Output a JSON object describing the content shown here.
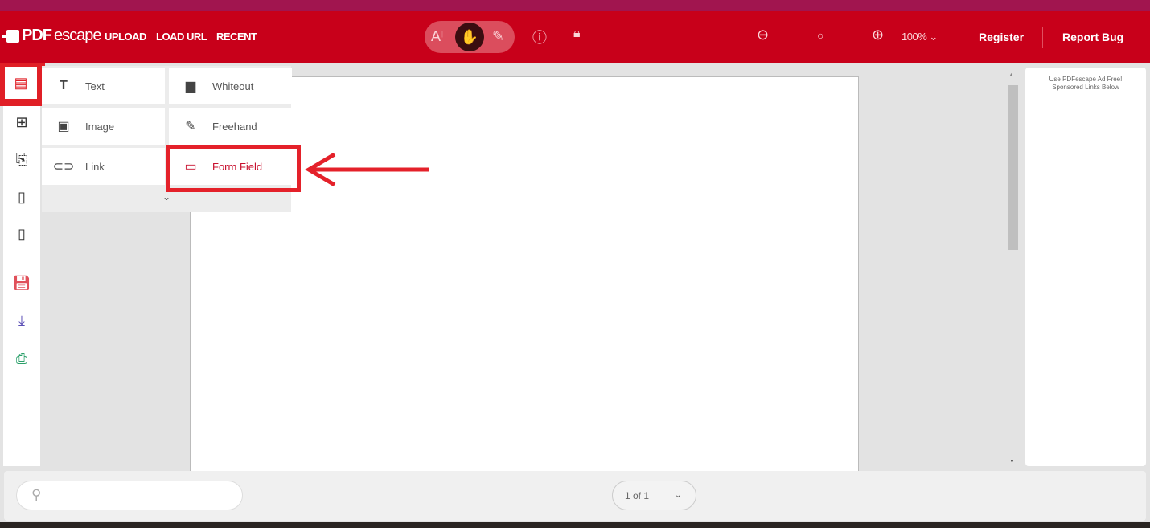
{
  "header": {
    "logo": "PDFescape",
    "logo_brand": "PDF",
    "logo_rest": "escape",
    "nav": [
      "UPLOAD",
      "LOAD URL",
      "RECENT"
    ],
    "zoom": "100%",
    "register": "Register",
    "report_bug": "Report Bug"
  },
  "menu": {
    "items": [
      {
        "label": "Text",
        "icon": "T"
      },
      {
        "label": "Whiteout",
        "icon": "whiteout-icon"
      },
      {
        "label": "Image",
        "icon": "image-icon"
      },
      {
        "label": "Freehand",
        "icon": "pencil-icon"
      },
      {
        "label": "Link",
        "icon": "link-icon"
      },
      {
        "label": "Form Field",
        "icon": "form-field-icon"
      }
    ]
  },
  "ad": {
    "line1": "Use PDFescape Ad Free!",
    "line2": "Sponsored Links Below"
  },
  "footer": {
    "search_placeholder": "",
    "page": "1 of 1"
  },
  "colors": {
    "header": "#c8001a",
    "highlight": "#e4212a",
    "form_field_text": "#c8102e"
  }
}
